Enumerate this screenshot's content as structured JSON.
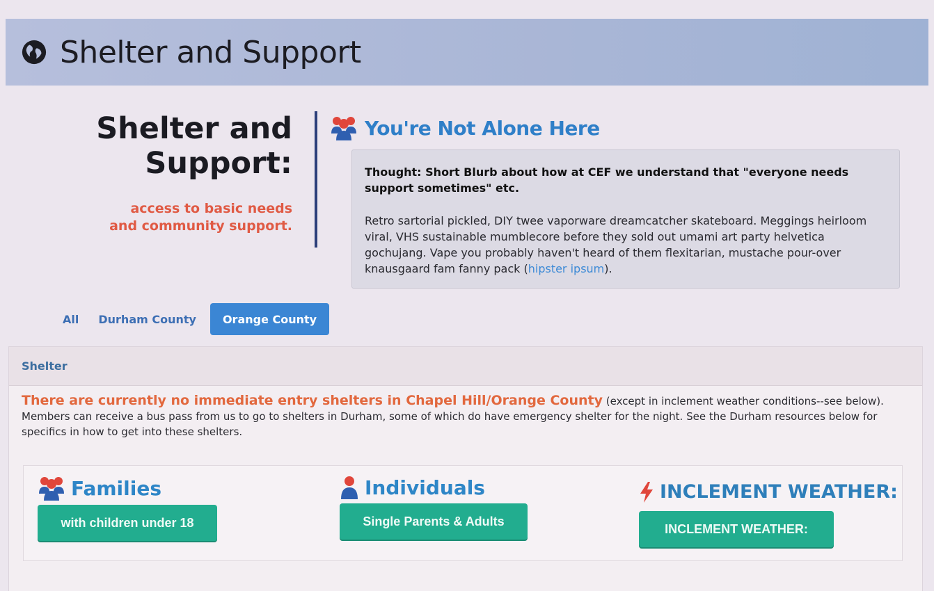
{
  "header": {
    "title": "Shelter and Support",
    "icon": "globe-icon"
  },
  "intro": {
    "heading_line1": "Shelter and",
    "heading_line2": "Support:",
    "sub_line1": "access to basic needs",
    "sub_line2": "and community support.",
    "right_title": "You're Not Alone Here",
    "right_icon": "group-icon",
    "thought": "Thought: Short Blurb about how at CEF we understand that \"everyone needs support sometimes\" etc.",
    "body": "Retro sartorial pickled, DIY twee vaporware dreamcatcher skateboard. Meggings heirloom viral, VHS sustainable mumblecore before they sold out umami art party helvetica gochujang. Vape you probably haven't heard of them flexitarian, mustache pour-over knausgaard fam fanny pack (",
    "link": "hipster ipsum",
    "body_end": ")."
  },
  "tabs": [
    {
      "label": "All"
    },
    {
      "label": "Durham County"
    },
    {
      "label": "Orange County",
      "active": true
    }
  ],
  "panel": {
    "title": "Shelter",
    "alert": "There are currently no immediate entry shelters in Chapel Hill/Orange County",
    "notice": " (except in inclement weather conditions--see below). Members can receive a bus pass from us to go to shelters in Durham, some of which do have emergency shelter for the night. See the Durham resources below for specifics in how to get into these shelters."
  },
  "cards": {
    "families": {
      "title": "Families",
      "button": "with children under 18",
      "icon": "group-icon"
    },
    "individuals": {
      "title": "Individuals",
      "button": "Single Parents & Adults",
      "icon": "user-icon"
    },
    "weather": {
      "title": "INCLEMENT WEATHER:",
      "button": "INCLEMENT WEATHER:",
      "icon": "lightning-icon"
    }
  },
  "colors": {
    "accent_blue": "#2f7fc8",
    "tab_active": "#3b86d4",
    "alert_orange": "#e2683e",
    "button_teal": "#22ad8f",
    "subtitle_red": "#e05a44"
  }
}
